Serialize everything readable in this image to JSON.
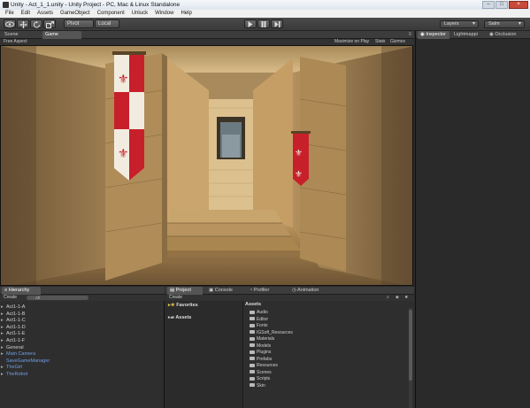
{
  "window": {
    "title": "Unity - Act_1_1.unity - Unity Project - PC, Mac & Linux Standalone"
  },
  "menu": [
    "File",
    "Edit",
    "Assets",
    "GameObject",
    "Component",
    "Unluck",
    "Window",
    "Help"
  ],
  "toolbar": {
    "pivot_label": "Pivot",
    "local_label": "Local",
    "layers_label": "Layers",
    "layout_label": "Salm"
  },
  "scene_tabs": {
    "scene": "Scene",
    "game": "Game"
  },
  "game_bar": {
    "aspect": "Free Aspect",
    "maximize": "Maximize on Play",
    "stats": "Stats",
    "gizmos": "Gizmos"
  },
  "inspector_tabs": {
    "inspector": "Inspector",
    "lightmapping": "Lightmappi",
    "occlusion": "Occlusion"
  },
  "hierarchy": {
    "tab": "Hierarchy",
    "create": "Create",
    "search_value": "All",
    "items": [
      {
        "label": "Act1-1-A",
        "expandable": true,
        "blue": false
      },
      {
        "label": "Act1-1-B",
        "expandable": true,
        "blue": false
      },
      {
        "label": "Act1-1-C",
        "expandable": true,
        "blue": false
      },
      {
        "label": "Act1-1-D",
        "expandable": true,
        "blue": false
      },
      {
        "label": "Act1-1-E",
        "expandable": true,
        "blue": false
      },
      {
        "label": "Act1-1-F",
        "expandable": true,
        "blue": false
      },
      {
        "label": "General",
        "expandable": true,
        "blue": false
      },
      {
        "label": "Main Camera",
        "expandable": true,
        "blue": true
      },
      {
        "label": "SaveGameManager",
        "expandable": false,
        "blue": true
      },
      {
        "label": "TheGirl",
        "expandable": true,
        "blue": true
      },
      {
        "label": "TheRobot",
        "expandable": true,
        "blue": true
      }
    ]
  },
  "project": {
    "tabs": [
      "Project",
      "Console",
      "Profiler",
      "Animation"
    ],
    "create": "Create",
    "favorites": "Favorites",
    "assets_tree": "Assets",
    "assets_header": "Assets",
    "folders": [
      "Audio",
      "Editor",
      "Fonts",
      "IGSoft_Resources",
      "Materials",
      "Models",
      "Plugins",
      "Prefabs",
      "Resources",
      "Scenes",
      "Scripts",
      "Skin"
    ]
  },
  "colors": {
    "editor_bg": "#2b2b2b",
    "panel_bg": "#2e2e2e",
    "accent_blue": "#6f9fe8",
    "banner_red": "#c8202a"
  }
}
